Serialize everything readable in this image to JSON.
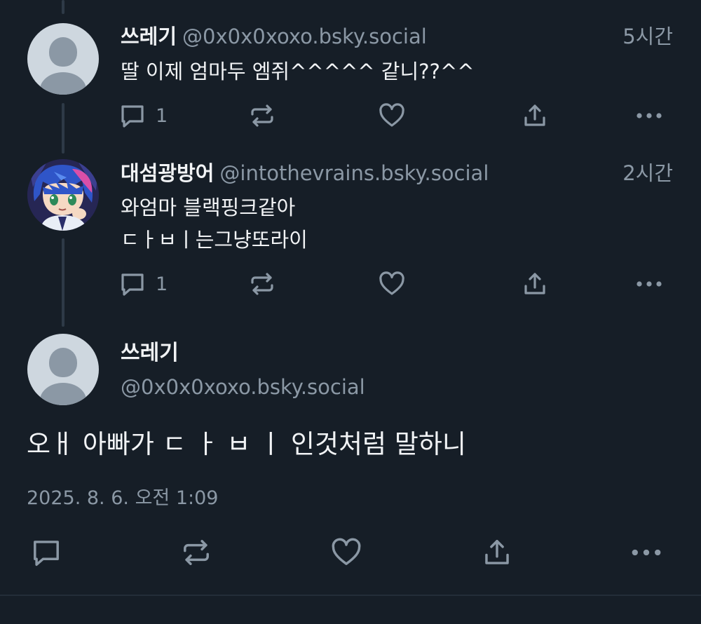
{
  "reply1": {
    "name": "쓰레기",
    "handle": "@0x0x0xoxo.bsky.social",
    "time": "5시간",
    "text": "딸 이제 엄마두 엠쥐^^^^^ 같니??^^",
    "reply_count": "1"
  },
  "reply2": {
    "name": "대섬광방어",
    "handle": "@intothevrains.bsky.social",
    "time": "2시간",
    "text_line1": "와엄마 블랙핑크같아",
    "text_line2": "ㄷㅏㅂㅣ는그냥또라이",
    "reply_count": "1"
  },
  "main_post": {
    "name": "쓰레기",
    "handle": "@0x0x0xoxo.bsky.social",
    "text": "오ㅐ 아빠가 ㄷ ㅏ ㅂ ㅣ 인것처럼 말하니",
    "timestamp": "2025. 8. 6. 오전 1:09"
  },
  "icons": {
    "reply": "reply-icon",
    "repost": "repost-icon",
    "like": "heart-icon",
    "share": "share-icon",
    "more": "more-icon"
  },
  "colors": {
    "background": "#161e27",
    "text": "#f1f3f5",
    "muted": "#8b98a5",
    "thread_line": "#2e3a47"
  }
}
